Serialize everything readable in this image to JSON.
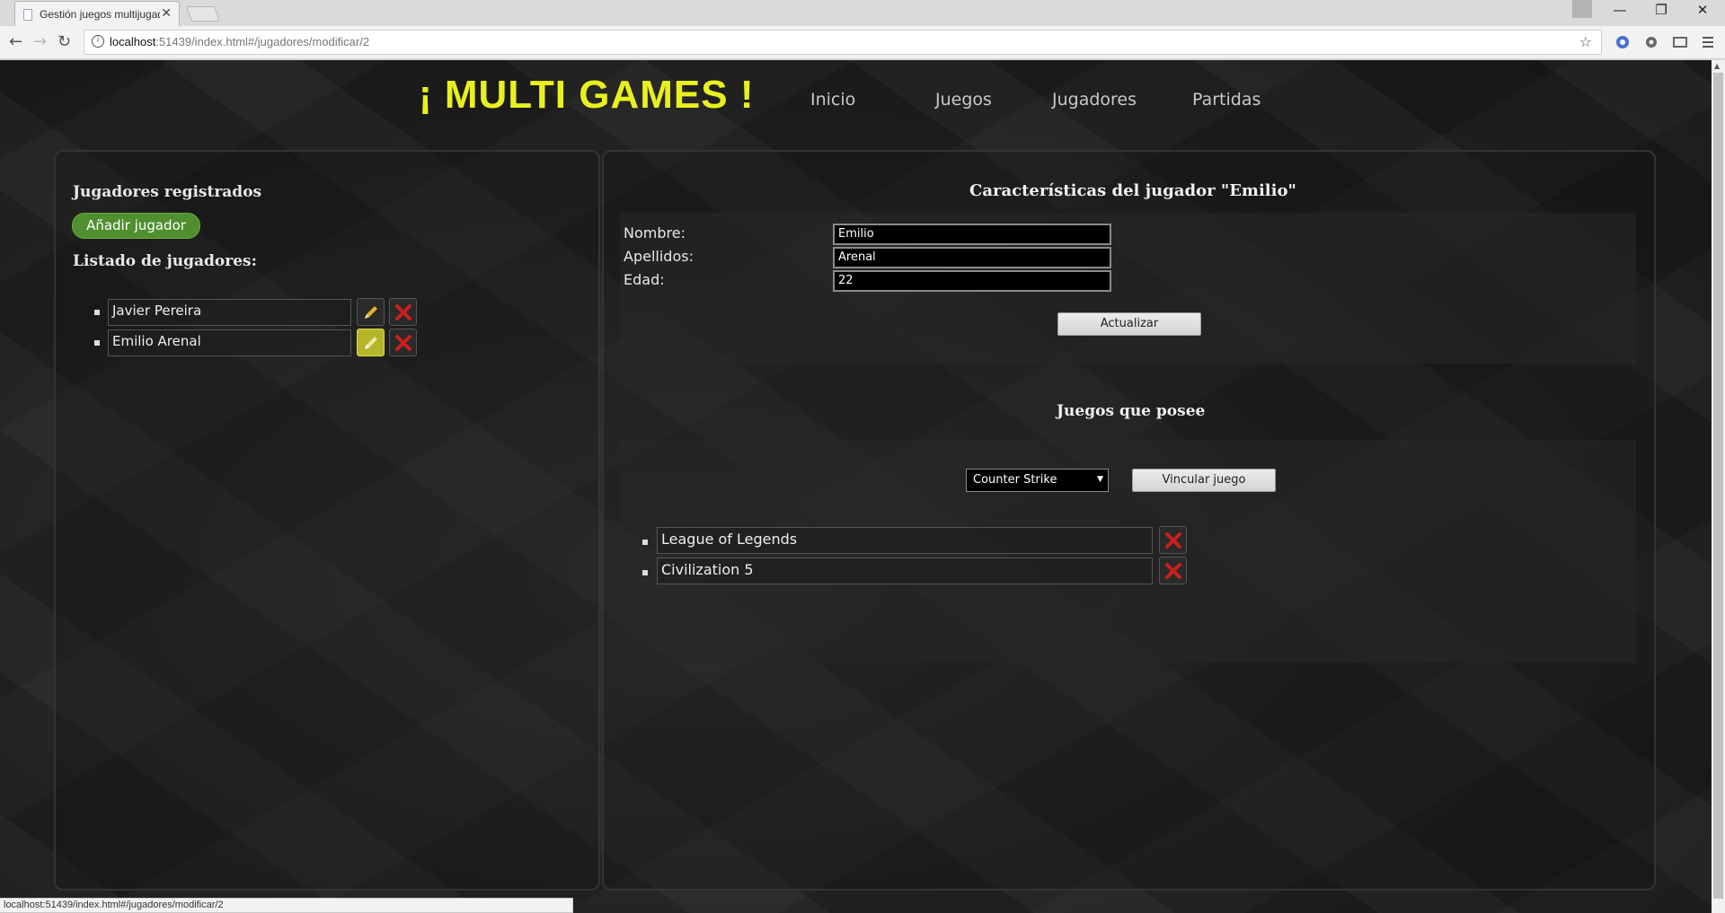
{
  "browser": {
    "tab_title": "Gestión juegos multijugador",
    "url_host": "localhost",
    "url_path": ":51439/index.html#/jugadores/modificar/2",
    "status_url": "localhost:51439/index.html#/jugadores/modificar/2"
  },
  "header": {
    "brand": "¡ MULTI GAMES !",
    "nav": [
      "Inicio",
      "Juegos",
      "Jugadores",
      "Partidas"
    ]
  },
  "left": {
    "title": "Jugadores registrados",
    "add_button": "Añadir jugador",
    "list_title": "Listado de jugadores:",
    "players": [
      {
        "name": "Javier Pereira",
        "editing": false
      },
      {
        "name": "Emilio Arenal",
        "editing": true
      }
    ]
  },
  "detail": {
    "title": "Características del jugador \"Emilio\"",
    "labels": {
      "nombre": "Nombre:",
      "apellidos": "Apellidos:",
      "edad": "Edad:"
    },
    "values": {
      "nombre": "Emilio",
      "apellidos": "Arenal",
      "edad": "22"
    },
    "update_button": "Actualizar",
    "games_title": "Juegos que posee",
    "select_value": "Counter Strike",
    "link_button": "Vincular juego",
    "games": [
      "League of Legends",
      "Civilization 5"
    ]
  },
  "colors": {
    "brand": "#e8f01e",
    "add_button": "#4f8f2f",
    "edit_active": "#b5b52a",
    "delete_x": "#c8201e"
  }
}
